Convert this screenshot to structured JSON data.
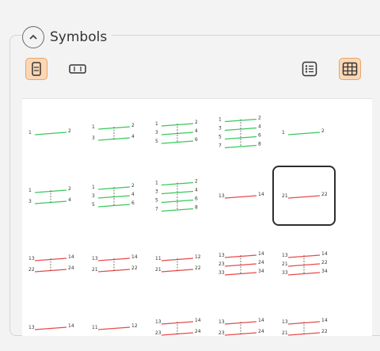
{
  "group": {
    "title": "Symbols"
  },
  "toolbar": {
    "portrait_icon": "portrait-layout-icon",
    "landscape_icon": "landscape-layout-icon",
    "list_icon": "list-view-icon",
    "grid_icon": "grid-view-icon"
  },
  "colors": {
    "accent": "#fcd7b5",
    "accent_border": "#e8a56a",
    "green": "#39c85a",
    "red": "#e84a4a"
  },
  "symbols": [
    {
      "kind": "g",
      "labels": [
        "1",
        "2"
      ]
    },
    {
      "kind": "g",
      "labels": [
        "1",
        "2",
        "3",
        "4"
      ]
    },
    {
      "kind": "g",
      "labels": [
        "1",
        "2",
        "3",
        "4",
        "5",
        "6"
      ]
    },
    {
      "kind": "g",
      "labels": [
        "1",
        "2",
        "3",
        "4",
        "5",
        "6",
        "7",
        "8"
      ]
    },
    {
      "kind": "g",
      "labels": [
        "1",
        "2"
      ]
    },
    {
      "kind": "g",
      "labels": [
        "1",
        "2",
        "3",
        "4"
      ]
    },
    {
      "kind": "g",
      "labels": [
        "1",
        "2",
        "3",
        "4",
        "5",
        "6"
      ]
    },
    {
      "kind": "g",
      "labels": [
        "1",
        "2",
        "3",
        "4",
        "5",
        "6",
        "7",
        "8"
      ]
    },
    {
      "kind": "r",
      "labels": [
        "13",
        "14"
      ]
    },
    {
      "kind": "r",
      "labels": [
        "21",
        "22"
      ],
      "selected": true
    },
    {
      "kind": "r",
      "labels": [
        "13",
        "14",
        "22",
        "24"
      ]
    },
    {
      "kind": "r",
      "labels": [
        "13",
        "14",
        "21",
        "22"
      ]
    },
    {
      "kind": "r",
      "labels": [
        "11",
        "12",
        "21",
        "22"
      ]
    },
    {
      "kind": "r",
      "labels": [
        "13",
        "14",
        "23",
        "24",
        "33",
        "34"
      ]
    },
    {
      "kind": "r",
      "labels": [
        "13",
        "14",
        "21",
        "22",
        "33",
        "34"
      ]
    },
    {
      "kind": "r",
      "labels": [
        "13",
        "14"
      ]
    },
    {
      "kind": "r",
      "labels": [
        "11",
        "12"
      ]
    },
    {
      "kind": "r",
      "labels": [
        "13",
        "14",
        "23",
        "24"
      ]
    },
    {
      "kind": "r",
      "labels": [
        "13",
        "14",
        "23",
        "24"
      ]
    },
    {
      "kind": "r",
      "labels": [
        "13",
        "14",
        "21",
        "22"
      ]
    }
  ]
}
